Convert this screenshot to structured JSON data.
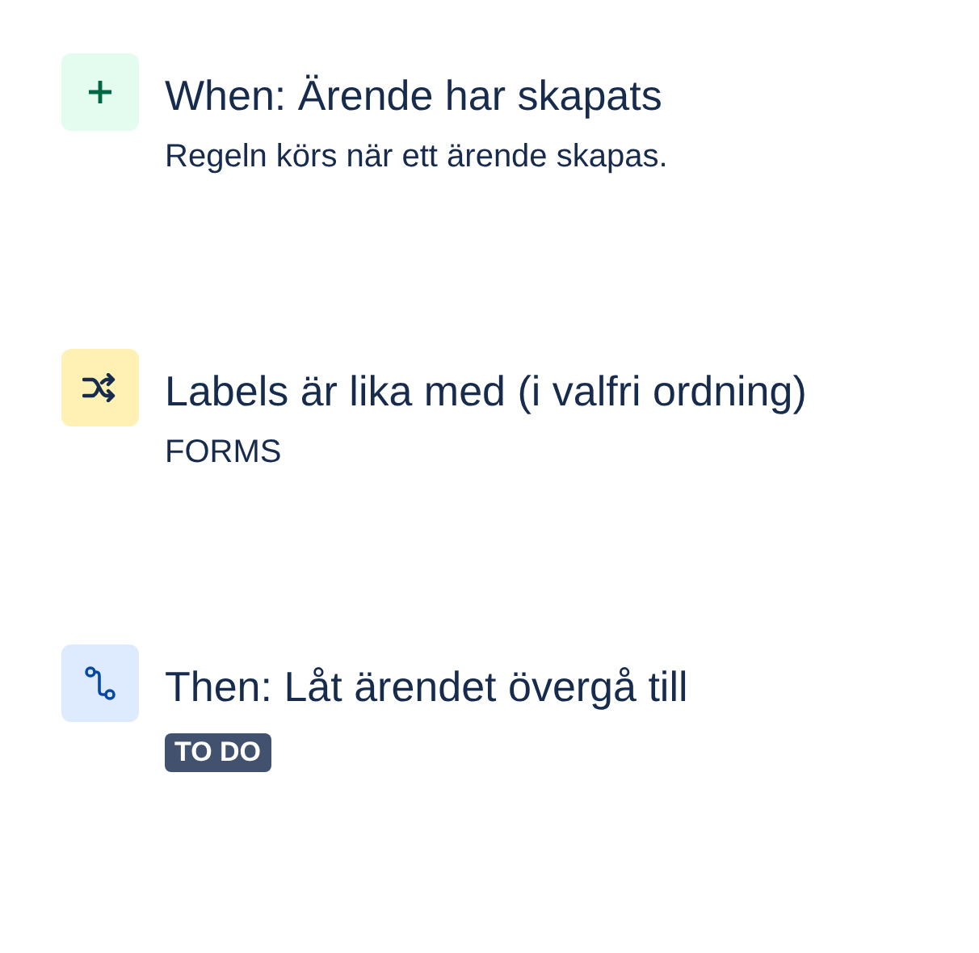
{
  "steps": [
    {
      "kind": "trigger",
      "title": "When: Ärende har skapats",
      "detail": {
        "kind": "text",
        "text": "Regeln körs när ett ärende skapas."
      }
    },
    {
      "kind": "condition",
      "title": "Labels är lika med (i valfri ordning)",
      "detail": {
        "kind": "text",
        "text": "FORMS"
      }
    },
    {
      "kind": "action",
      "title": "Then: Låt ärendet övergå till",
      "detail": {
        "kind": "status",
        "text": "TO DO"
      }
    }
  ]
}
